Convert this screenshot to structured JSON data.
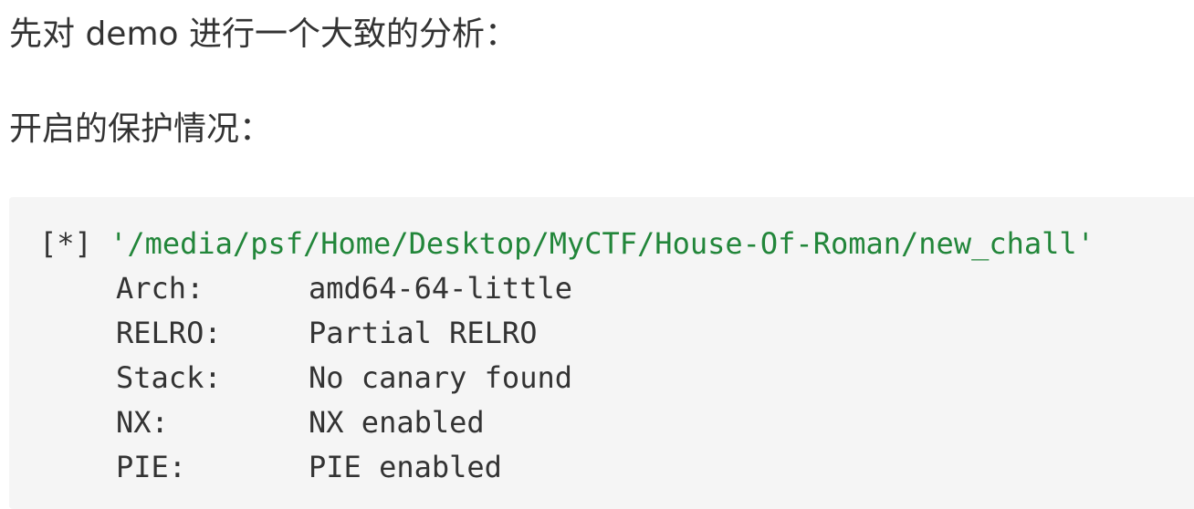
{
  "paragraphs": {
    "intro": "先对 demo 进行一个大致的分析：",
    "protections": "开启的保护情况："
  },
  "code": {
    "prefix": "[*]",
    "path": "'/media/psf/Home/Desktop/MyCTF/House-Of-Roman/new_chall'",
    "rows": [
      {
        "key": "Arch:",
        "value": "amd64-64-little"
      },
      {
        "key": "RELRO:",
        "value": "Partial RELRO"
      },
      {
        "key": "Stack:",
        "value": "No canary found"
      },
      {
        "key": "NX:",
        "value": "NX enabled"
      },
      {
        "key": "PIE:",
        "value": "PIE enabled"
      }
    ]
  },
  "colors": {
    "text": "#333333",
    "string": "#22863a",
    "code_background": "#f5f5f5"
  }
}
